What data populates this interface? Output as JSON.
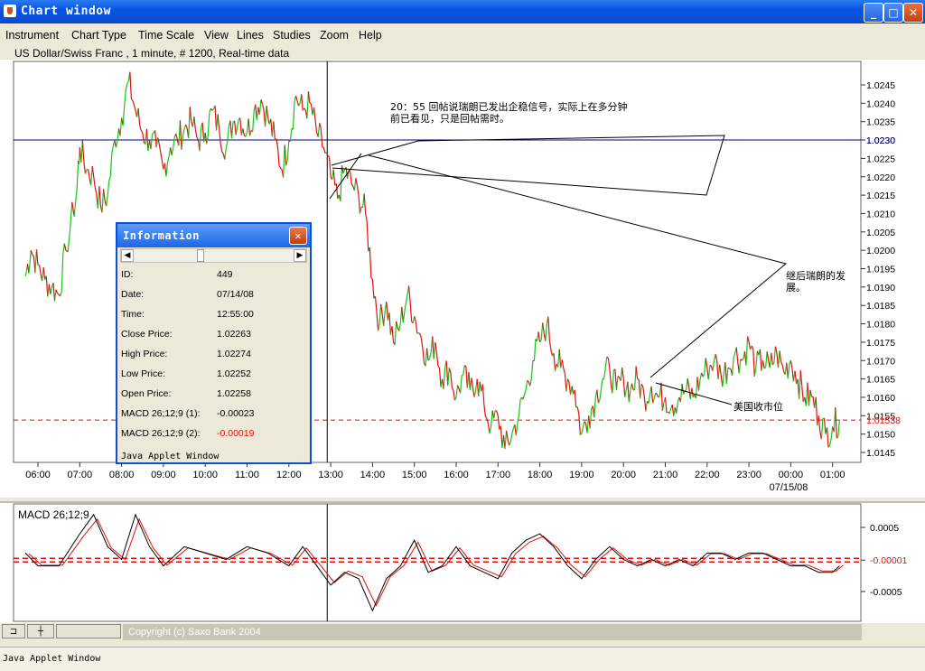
{
  "window": {
    "title": "Chart window",
    "min": "_",
    "max": "□",
    "close": "✕"
  },
  "menu": [
    "Instrument",
    "Chart Type",
    "Time Scale",
    "View",
    "Lines",
    "Studies",
    "Zoom",
    "Help"
  ],
  "chart_header": "US Dollar/Swiss Franc , 1 minute, # 1200, Real-time data",
  "colors": {
    "up": "#1BC21B",
    "down": "#E01010",
    "hline": "#000080",
    "dashed": "#E01010",
    "titlebar": "#0854E3"
  },
  "chart_data": {
    "type": "line",
    "title": "US Dollar/Swiss Franc , 1 minute, # 1200, Real-time data",
    "x_ticks": [
      "06:00",
      "07:00",
      "08:00",
      "09:00",
      "10:00",
      "11:00",
      "12:00",
      "13:00",
      "14:00",
      "15:00",
      "16:00",
      "17:00",
      "18:00",
      "19:00",
      "20:00",
      "21:00",
      "22:00",
      "23:00",
      "00:00",
      "01:00"
    ],
    "x_date_label": "07/15/08",
    "y_ticks": [
      "1.0245",
      "1.0240",
      "1.0235",
      "1.0230",
      "1.0225",
      "1.0220",
      "1.0215",
      "1.0210",
      "1.0205",
      "1.0200",
      "1.0195",
      "1.0190",
      "1.0185",
      "1.0180",
      "1.0175",
      "1.0170",
      "1.0165",
      "1.0160",
      "1.0155",
      "1.0150",
      "1.0145"
    ],
    "ylim": [
      1.0143,
      1.025
    ],
    "horizontal_line": {
      "value": 1.023,
      "label": "1.0230"
    },
    "current_price": {
      "value": 1.01538,
      "label": "1.01538"
    },
    "cursor_time": "12:55",
    "price_path": [
      [
        "05:42",
        1.0193
      ],
      [
        "05:50",
        1.02
      ],
      [
        "06:00",
        1.0196
      ],
      [
        "06:10",
        1.0192
      ],
      [
        "06:20",
        1.019
      ],
      [
        "06:30",
        1.0188
      ],
      [
        "06:40",
        1.02
      ],
      [
        "06:55",
        1.0215
      ],
      [
        "07:00",
        1.0228
      ],
      [
        "07:10",
        1.0222
      ],
      [
        "07:20",
        1.022
      ],
      [
        "07:30",
        1.0212
      ],
      [
        "07:40",
        1.0215
      ],
      [
        "07:50",
        1.023
      ],
      [
        "08:00",
        1.0236
      ],
      [
        "08:10",
        1.0246
      ],
      [
        "08:20",
        1.0238
      ],
      [
        "08:30",
        1.0232
      ],
      [
        "08:40",
        1.023
      ],
      [
        "08:50",
        1.0228
      ],
      [
        "09:00",
        1.0222
      ],
      [
        "09:10",
        1.0228
      ],
      [
        "09:20",
        1.023
      ],
      [
        "09:30",
        1.0233
      ],
      [
        "09:40",
        1.0235
      ],
      [
        "09:50",
        1.023
      ],
      [
        "10:00",
        1.0232
      ],
      [
        "10:10",
        1.0238
      ],
      [
        "10:20",
        1.0233
      ],
      [
        "10:30",
        1.0228
      ],
      [
        "10:40",
        1.0235
      ],
      [
        "10:50",
        1.0236
      ],
      [
        "11:00",
        1.0232
      ],
      [
        "11:10",
        1.0238
      ],
      [
        "11:20",
        1.0241
      ],
      [
        "11:30",
        1.0236
      ],
      [
        "11:40",
        1.023
      ],
      [
        "11:50",
        1.0222
      ],
      [
        "12:00",
        1.023
      ],
      [
        "12:10",
        1.0242
      ],
      [
        "12:20",
        1.0238
      ],
      [
        "12:30",
        1.024
      ],
      [
        "12:40",
        1.0232
      ],
      [
        "12:50",
        1.0228
      ],
      [
        "13:00",
        1.022
      ],
      [
        "13:10",
        1.0214
      ],
      [
        "13:20",
        1.0222
      ],
      [
        "13:30",
        1.0218
      ],
      [
        "13:40",
        1.0215
      ],
      [
        "13:50",
        1.021
      ],
      [
        "14:00",
        1.0192
      ],
      [
        "14:10",
        1.018
      ],
      [
        "14:20",
        1.0186
      ],
      [
        "14:30",
        1.0175
      ],
      [
        "14:40",
        1.018
      ],
      [
        "14:50",
        1.0188
      ],
      [
        "15:00",
        1.0182
      ],
      [
        "15:10",
        1.0176
      ],
      [
        "15:20",
        1.017
      ],
      [
        "15:30",
        1.0175
      ],
      [
        "15:40",
        1.0165
      ],
      [
        "15:50",
        1.0168
      ],
      [
        "16:00",
        1.016
      ],
      [
        "16:10",
        1.0166
      ],
      [
        "16:20",
        1.0162
      ],
      [
        "16:30",
        1.0165
      ],
      [
        "16:40",
        1.0158
      ],
      [
        "16:50",
        1.0152
      ],
      [
        "17:00",
        1.0155
      ],
      [
        "17:10",
        1.0146
      ],
      [
        "17:20",
        1.015
      ],
      [
        "17:30",
        1.0155
      ],
      [
        "17:40",
        1.0162
      ],
      [
        "17:50",
        1.017
      ],
      [
        "18:00",
        1.0175
      ],
      [
        "18:10",
        1.018
      ],
      [
        "18:20",
        1.0172
      ],
      [
        "18:30",
        1.0168
      ],
      [
        "18:40",
        1.0165
      ],
      [
        "18:50",
        1.0162
      ],
      [
        "19:00",
        1.015
      ],
      [
        "19:10",
        1.0155
      ],
      [
        "19:20",
        1.016
      ],
      [
        "19:30",
        1.0165
      ],
      [
        "19:40",
        1.0168
      ],
      [
        "19:50",
        1.0162
      ],
      [
        "20:00",
        1.0165
      ],
      [
        "20:10",
        1.0162
      ],
      [
        "20:20",
        1.0165
      ],
      [
        "20:30",
        1.016
      ],
      [
        "20:40",
        1.0163
      ],
      [
        "20:50",
        1.016
      ],
      [
        "21:00",
        1.016
      ],
      [
        "21:10",
        1.0158
      ],
      [
        "21:20",
        1.016
      ],
      [
        "21:30",
        1.0162
      ],
      [
        "21:40",
        1.016
      ],
      [
        "21:50",
        1.0165
      ],
      [
        "22:00",
        1.0168
      ],
      [
        "22:10",
        1.017
      ],
      [
        "22:20",
        1.0166
      ],
      [
        "22:30",
        1.0168
      ],
      [
        "22:40",
        1.0172
      ],
      [
        "22:50",
        1.017
      ],
      [
        "23:00",
        1.0175
      ],
      [
        "23:10",
        1.0168
      ],
      [
        "23:20",
        1.017
      ],
      [
        "23:30",
        1.0168
      ],
      [
        "23:40",
        1.0172
      ],
      [
        "23:50",
        1.0167
      ],
      [
        "00:00",
        1.017
      ],
      [
        "00:10",
        1.0165
      ],
      [
        "00:20",
        1.016
      ],
      [
        "00:30",
        1.016
      ],
      [
        "00:40",
        1.0155
      ],
      [
        "00:50",
        1.015
      ],
      [
        "01:00",
        1.0152
      ],
      [
        "01:10",
        1.0154
      ]
    ],
    "macd": {
      "title": "MACD 26;12;9",
      "y_ticks": [
        "0.0005",
        "-0.00001",
        "-0.0005"
      ],
      "ylim": [
        -0.0009,
        0.0009
      ],
      "signal_value": -1e-05,
      "series": [
        [
          "05:42",
          0.0001
        ],
        [
          "06:00",
          -0.0001
        ],
        [
          "06:30",
          -0.0001
        ],
        [
          "07:00",
          0.0004
        ],
        [
          "07:20",
          0.0007
        ],
        [
          "07:40",
          0.0002
        ],
        [
          "08:00",
          0.0
        ],
        [
          "08:20",
          0.0007
        ],
        [
          "08:40",
          0.0002
        ],
        [
          "09:00",
          -0.0001
        ],
        [
          "09:30",
          0.0002
        ],
        [
          "10:00",
          0.0001
        ],
        [
          "10:30",
          0.0
        ],
        [
          "11:00",
          0.0002
        ],
        [
          "11:30",
          0.0001
        ],
        [
          "12:00",
          -0.0001
        ],
        [
          "12:20",
          0.0002
        ],
        [
          "12:40",
          -0.0001
        ],
        [
          "13:00",
          -0.0004
        ],
        [
          "13:20",
          -0.0002
        ],
        [
          "13:40",
          -0.0003
        ],
        [
          "14:00",
          -0.0008
        ],
        [
          "14:20",
          -0.0003
        ],
        [
          "14:40",
          -0.0001
        ],
        [
          "15:00",
          0.0003
        ],
        [
          "15:20",
          -0.0002
        ],
        [
          "15:40",
          -0.0001
        ],
        [
          "16:00",
          0.0002
        ],
        [
          "16:20",
          -0.0001
        ],
        [
          "16:40",
          -0.0002
        ],
        [
          "17:00",
          -0.0003
        ],
        [
          "17:20",
          0.0001
        ],
        [
          "17:40",
          0.0003
        ],
        [
          "18:00",
          0.0004
        ],
        [
          "18:20",
          0.0002
        ],
        [
          "18:40",
          -0.0001
        ],
        [
          "19:00",
          -0.0003
        ],
        [
          "19:20",
          0.0
        ],
        [
          "19:40",
          0.0002
        ],
        [
          "20:00",
          0.0
        ],
        [
          "20:20",
          -0.0001
        ],
        [
          "20:40",
          0.0
        ],
        [
          "21:00",
          -0.0001
        ],
        [
          "21:20",
          0.0
        ],
        [
          "21:40",
          -0.0001
        ],
        [
          "22:00",
          0.0001
        ],
        [
          "22:20",
          0.0001
        ],
        [
          "22:40",
          0.0
        ],
        [
          "23:00",
          0.0001
        ],
        [
          "23:20",
          0.0001
        ],
        [
          "23:40",
          0.0
        ],
        [
          "00:00",
          -0.0001
        ],
        [
          "00:20",
          -0.0001
        ],
        [
          "00:40",
          -0.0002
        ],
        [
          "01:00",
          -0.0002
        ],
        [
          "01:10",
          -0.0001
        ]
      ]
    }
  },
  "annotations": {
    "note1_line1": "20：55 回帖说瑞朗已发出企稳信号，实际上在多分钟",
    "note1_line2": "前已看见，只是回帖需时。",
    "note2_line1": "继后瑞朗的发",
    "note2_line2": "展。",
    "note3": "美国收市位"
  },
  "info": {
    "title": "Information",
    "close": "✕",
    "rows": [
      {
        "label": "ID:",
        "value": "449"
      },
      {
        "label": "Date:",
        "value": "07/14/08"
      },
      {
        "label": "Time:",
        "value": "12:55:00"
      },
      {
        "label": "Close Price:",
        "value": "1.02263"
      },
      {
        "label": "High Price:",
        "value": "1.02274"
      },
      {
        "label": "Low Price:",
        "value": "1.02252"
      },
      {
        "label": "Open Price:",
        "value": "1.02258"
      },
      {
        "label": "MACD 26;12;9 (1):",
        "value": "-0.00023"
      },
      {
        "label": "MACD 26;12;9 (2):",
        "value": "-0.00019"
      }
    ],
    "footer": "Java Applet Window"
  },
  "bottom": {
    "btn1": "⊐",
    "btn2": "┼",
    "copyright": "Copyright (c) Saxo Bank 2004"
  },
  "status": "Java Applet Window"
}
